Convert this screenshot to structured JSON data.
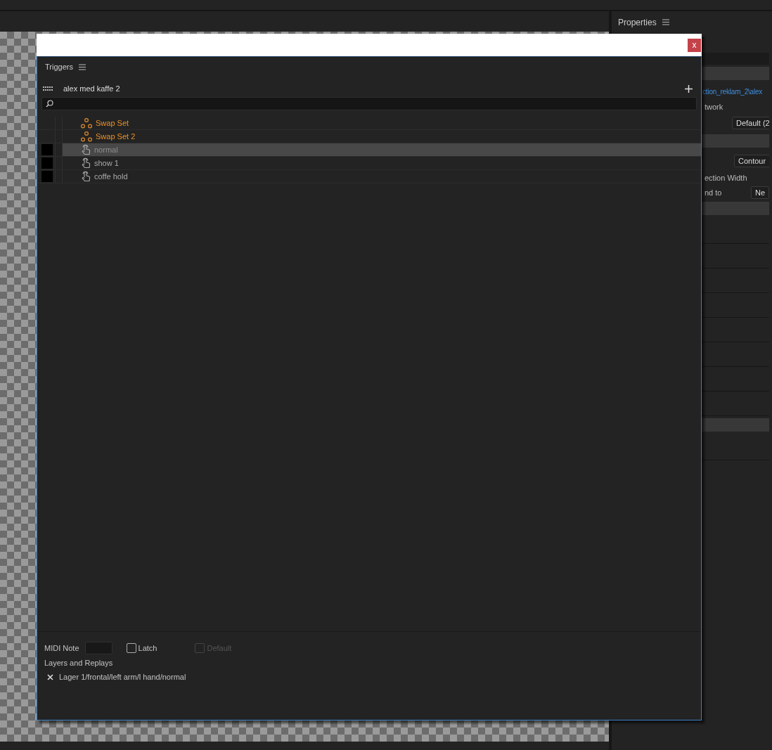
{
  "properties_panel": {
    "title": "Properties",
    "rows": [
      {
        "kind": "bar"
      },
      {
        "kind": "header"
      },
      {
        "kind": "link",
        "text": "ction_reklam_2\\alex"
      },
      {
        "kind": "text",
        "text": "twork"
      },
      {
        "kind": "dropdown",
        "text": "Default (2"
      },
      {
        "kind": "header"
      },
      {
        "kind": "button",
        "text": "Contour"
      },
      {
        "kind": "text",
        "text": "ection Width"
      },
      {
        "kind": "labeled_dropdown",
        "label": "nd to",
        "value": "Ne"
      },
      {
        "kind": "header"
      },
      {
        "kind": "row"
      },
      {
        "kind": "row"
      },
      {
        "kind": "row"
      },
      {
        "kind": "row"
      },
      {
        "kind": "row"
      },
      {
        "kind": "row"
      },
      {
        "kind": "row"
      },
      {
        "kind": "row"
      },
      {
        "kind": "header"
      },
      {
        "kind": "row"
      }
    ]
  },
  "dialog": {
    "close": "x",
    "panel_title": "Triggers",
    "puppet": "alex med kaffe 2",
    "triggers": [
      {
        "kind": "swap_set",
        "label": "Swap Set",
        "selected": false
      },
      {
        "kind": "swap_set",
        "label": "Swap Set 2",
        "selected": false
      },
      {
        "kind": "trigger",
        "label": "normal",
        "selected": true
      },
      {
        "kind": "trigger",
        "label": "show 1",
        "selected": false
      },
      {
        "kind": "trigger",
        "label": "coffe hold",
        "selected": false
      }
    ],
    "midi_note": {
      "label": "MIDI Note"
    },
    "latch": {
      "label": "Latch",
      "checked": false,
      "disabled": false
    },
    "default": {
      "label": "Default",
      "checked": false,
      "disabled": true
    },
    "layers_title": "Layers and Replays",
    "layers": [
      "Lager 1/frontal/left arm/l hand/normal"
    ]
  }
}
